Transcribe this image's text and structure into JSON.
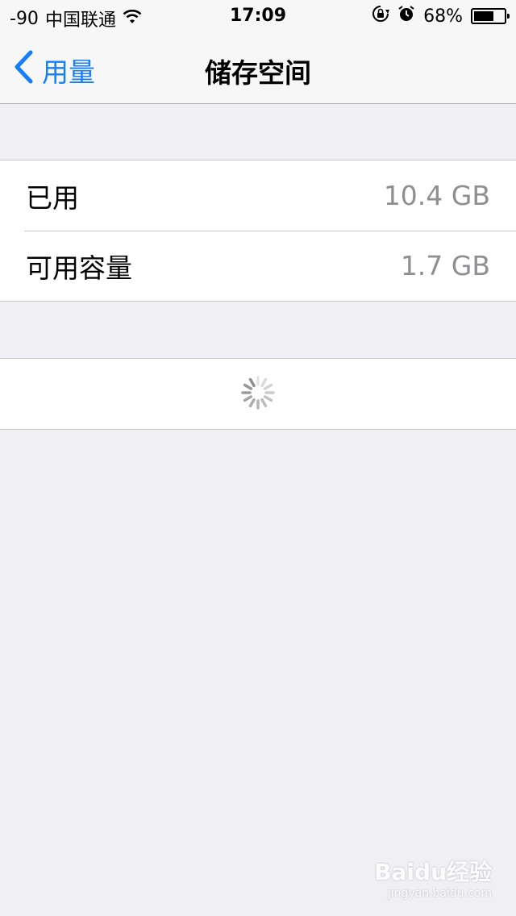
{
  "status_bar": {
    "signal": "-90",
    "carrier": "中国联通",
    "time": "17:09",
    "battery_percent": "68%",
    "battery_level": 0.68,
    "icons": [
      "wifi-icon",
      "rotation-lock-icon",
      "alarm-icon",
      "battery-icon"
    ]
  },
  "nav": {
    "back_label": "用量",
    "title": "储存空间"
  },
  "storage": {
    "rows": [
      {
        "label": "已用",
        "value": "10.4 GB"
      },
      {
        "label": "可用容量",
        "value": "1.7 GB"
      }
    ]
  },
  "loading": {
    "indicator": "spinner-icon"
  },
  "watermark": {
    "brand": "Baidu经验",
    "domain": "jingyan.baidu.com"
  },
  "colors": {
    "accent": "#157efb",
    "background": "#efeff4",
    "secondary_text": "#8e8e93",
    "separator": "#c8c7cc"
  }
}
